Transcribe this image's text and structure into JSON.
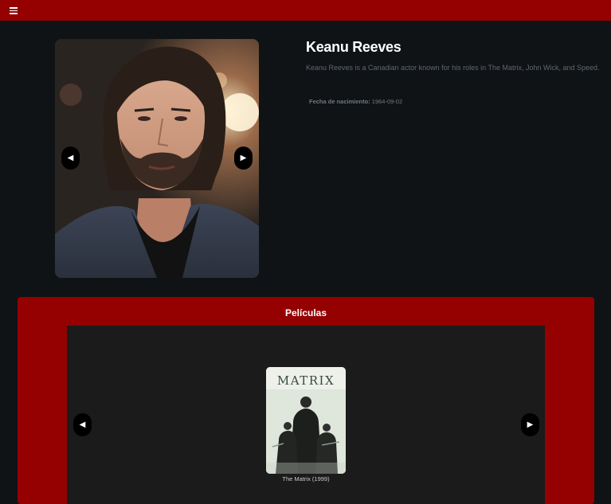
{
  "header": {
    "menu_icon": "hamburger-menu-icon",
    "background": "#950000"
  },
  "actor": {
    "name": "Keanu Reeves",
    "bio": "Keanu Reeves is a Canadian actor known for his roles in The Matrix, John Wick, and Speed.",
    "birth_label": "Fecha de nacimiento:",
    "birth_date": "1964-09-02",
    "photo_prev_icon": "◀",
    "photo_next_icon": "▶"
  },
  "films": {
    "title": "Películas",
    "prev_icon": "◀",
    "next_icon": "▶",
    "items": [
      {
        "poster_title": "MATRIX",
        "caption": "The Matrix (1999)"
      }
    ]
  }
}
